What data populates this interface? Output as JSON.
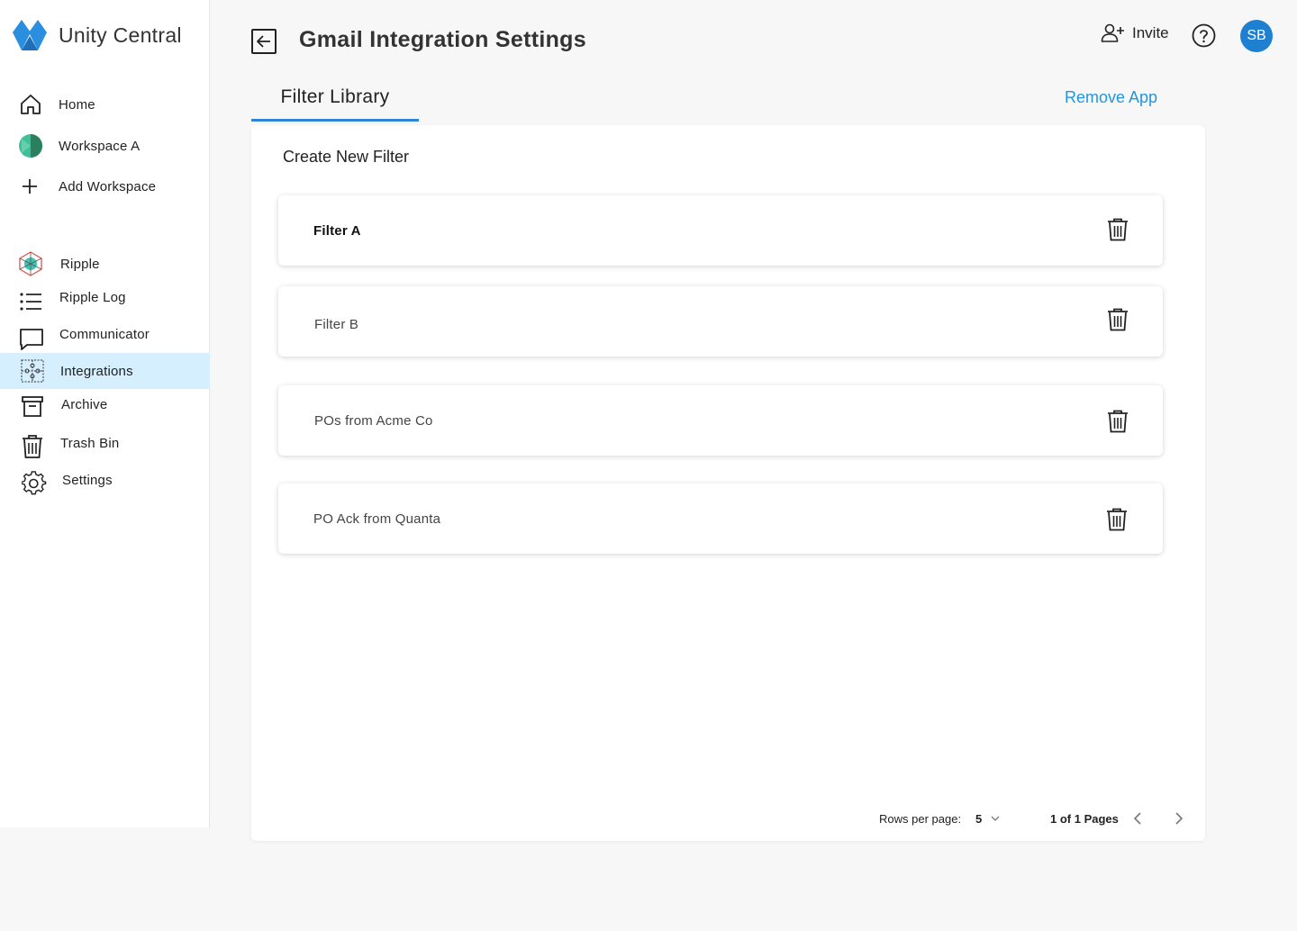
{
  "app": {
    "name": "Unity Central",
    "brand_colors": {
      "primary": "#2196e0",
      "secondary": "#1f7fd1"
    }
  },
  "sidebar": {
    "items": [
      {
        "label": "Home",
        "icon": "home-icon"
      },
      {
        "label": "Workspace A",
        "icon": "workspace-icon"
      },
      {
        "label": "Add Workspace",
        "icon": "plus-icon"
      },
      {
        "label": "Ripple",
        "icon": "ripple-icon"
      },
      {
        "label": "Ripple Log",
        "icon": "list-icon"
      },
      {
        "label": "Communicator",
        "icon": "chat-icon"
      },
      {
        "label": "Integrations",
        "icon": "puzzle-icon",
        "active": true
      },
      {
        "label": "Archive",
        "icon": "archive-icon"
      },
      {
        "label": "Trash Bin",
        "icon": "trash-icon"
      },
      {
        "label": "Settings",
        "icon": "gear-icon"
      }
    ],
    "active_color": "#d6efff"
  },
  "header": {
    "title": "Gmail Integration Settings",
    "invite_label": "Invite",
    "avatar_initials": "SB"
  },
  "tabs": {
    "active_label": "Filter Library"
  },
  "actions": {
    "remove_app": "Remove App",
    "create_filter": "Create New Filter"
  },
  "filters": [
    {
      "name": "Filter A",
      "selected": true
    },
    {
      "name": "Filter B",
      "selected": false
    },
    {
      "name": "POs from Acme Co",
      "selected": false
    },
    {
      "name": "PO Ack from Quanta",
      "selected": false
    }
  ],
  "pagination": {
    "rows_per_page_label": "Rows per page:",
    "rows_per_page_value": "5",
    "page_status": "1 of 1 Pages"
  }
}
